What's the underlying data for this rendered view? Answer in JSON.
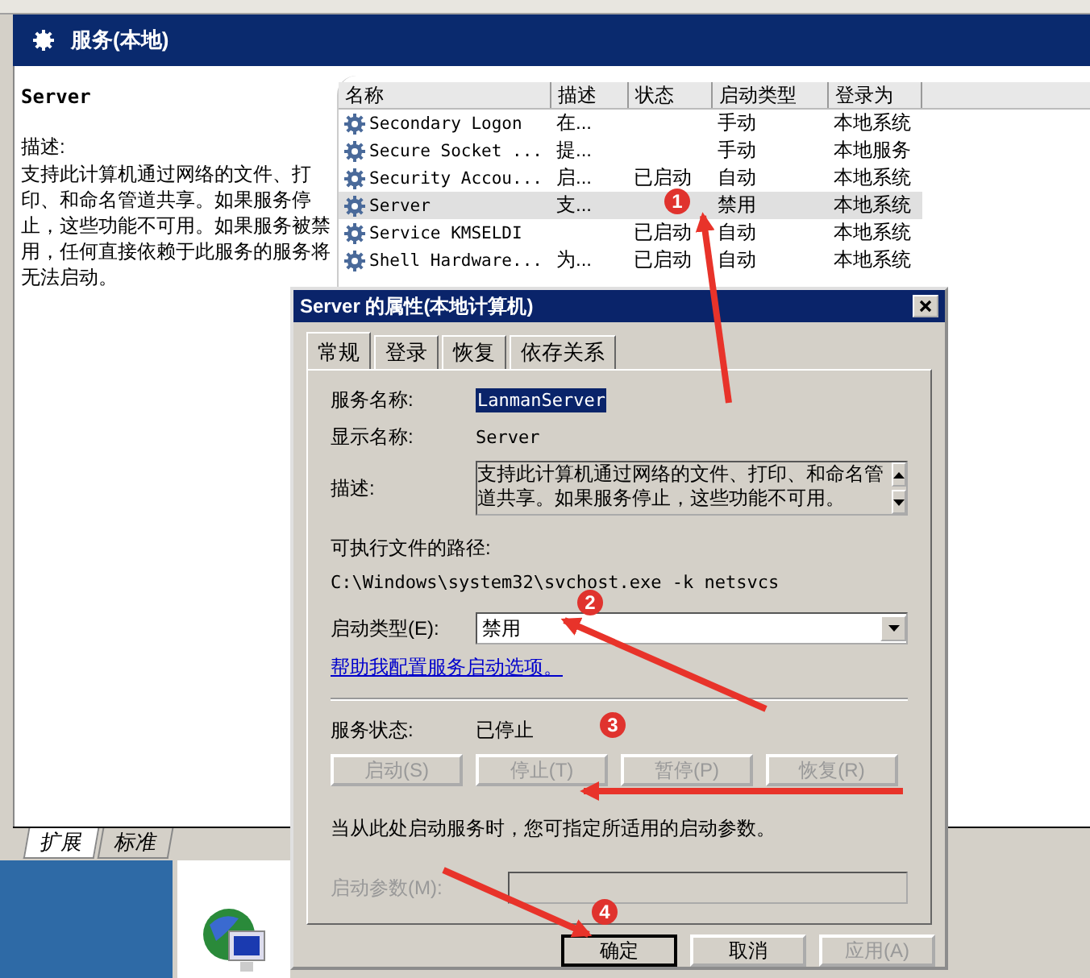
{
  "header": {
    "title": "服务(本地)"
  },
  "detail": {
    "name": "Server",
    "description_label": "描述:",
    "description": "支持此计算机通过网络的文件、打印、和命名管道共享。如果服务停止，这些功能不可用。如果服务被禁用，任何直接依赖于此服务的服务将无法启动。"
  },
  "table": {
    "columns": [
      "名称",
      "描述",
      "状态",
      "启动类型",
      "登录为"
    ],
    "rows": [
      {
        "cells": [
          "Secondary Logon",
          "在...",
          "",
          "手动",
          "本地系统"
        ],
        "selected": false
      },
      {
        "cells": [
          "Secure Socket ...",
          "提...",
          "",
          "手动",
          "本地服务"
        ],
        "selected": false
      },
      {
        "cells": [
          "Security Accou...",
          "启...",
          "已启动",
          "自动",
          "本地系统"
        ],
        "selected": false
      },
      {
        "cells": [
          "Server",
          "支...",
          "",
          "禁用",
          "本地系统"
        ],
        "selected": true
      },
      {
        "cells": [
          "Service KMSELDI",
          "",
          "已启动",
          "自动",
          "本地系统"
        ],
        "selected": false
      },
      {
        "cells": [
          "Shell Hardware...",
          "为...",
          "已启动",
          "自动",
          "本地系统"
        ],
        "selected": false
      }
    ]
  },
  "view_tabs": [
    {
      "label": "扩展",
      "selected": true
    },
    {
      "label": "标准",
      "selected": false
    }
  ],
  "dialog": {
    "title": "Server 的属性(本地计算机)",
    "tabs": [
      {
        "label": "常规",
        "selected": true
      },
      {
        "label": "登录",
        "selected": false
      },
      {
        "label": "恢复",
        "selected": false
      },
      {
        "label": "依存关系",
        "selected": false
      }
    ],
    "service_name_label": "服务名称:",
    "service_name": "LanmanServer",
    "display_name_label": "显示名称:",
    "display_name": "Server",
    "description_label": "描述:",
    "description": "支持此计算机通过网络的文件、打印、和命名管道共享。如果服务停止，这些功能不可用。",
    "path_label": "可执行文件的路径:",
    "path": "C:\\Windows\\system32\\svchost.exe -k netsvcs",
    "startup_type_label": "启动类型(E):",
    "startup_type": "禁用",
    "help_link": "帮助我配置服务启动选项。",
    "status_label": "服务状态:",
    "status": "已停止",
    "control_buttons": [
      {
        "label": "启动(S)",
        "disabled": true
      },
      {
        "label": "停止(T)",
        "disabled": true
      },
      {
        "label": "暂停(P)",
        "disabled": true
      },
      {
        "label": "恢复(R)",
        "disabled": true
      }
    ],
    "hint": "当从此处启动服务时，您可指定所适用的启动参数。",
    "parameters_label": "启动参数(M):",
    "parameters_disabled": true,
    "buttons": [
      {
        "label": "确定",
        "disabled": false,
        "default": true
      },
      {
        "label": "取消",
        "disabled": false,
        "default": false
      },
      {
        "label": "应用(A)",
        "disabled": true,
        "default": false
      }
    ]
  },
  "annotations": [
    {
      "number": "1"
    },
    {
      "number": "2"
    },
    {
      "number": "3"
    },
    {
      "number": "4"
    }
  ]
}
